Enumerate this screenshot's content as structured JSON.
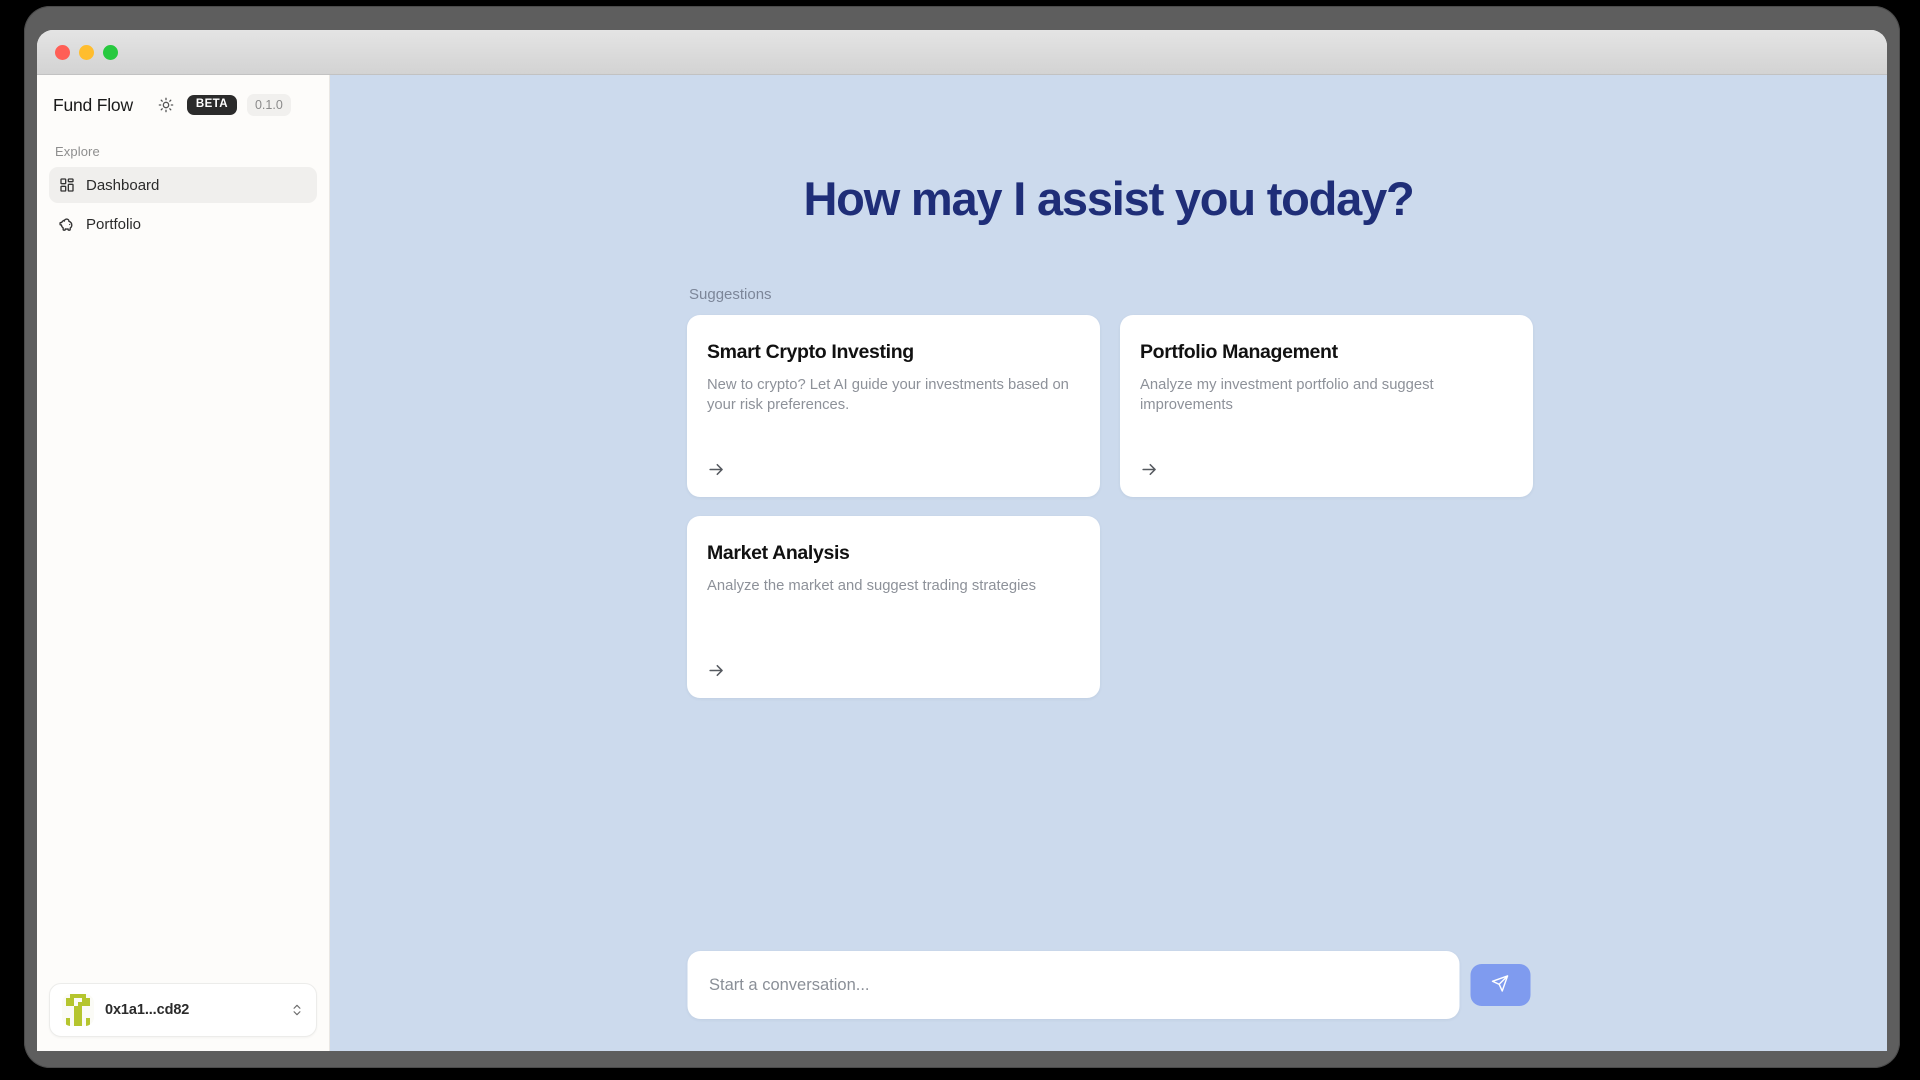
{
  "window": {
    "traffic_lights": [
      "close",
      "minimize",
      "maximize"
    ]
  },
  "sidebar": {
    "brand": "Fund Flow",
    "theme_toggle_icon": "sun-icon",
    "beta_badge": "BETA",
    "version": "0.1.0",
    "section_label": "Explore",
    "items": [
      {
        "label": "Dashboard",
        "icon": "dashboard-grid-icon",
        "active": true
      },
      {
        "label": "Portfolio",
        "icon": "piggy-bank-icon",
        "active": false
      }
    ],
    "wallet": {
      "address": "0x1a1...cd82",
      "avatar_icon": "wallet-identicon",
      "avatar_color": "#b5c52e",
      "chevron_icon": "chevron-up-down-icon"
    }
  },
  "main": {
    "hero_title": "How may I assist you today?",
    "suggestions_label": "Suggestions",
    "suggestions": [
      {
        "title": "Smart Crypto Investing",
        "description": "New to crypto? Let AI guide your investments based on your risk preferences.",
        "arrow_icon": "arrow-right-icon"
      },
      {
        "title": "Portfolio Management",
        "description": "Analyze my investment portfolio and suggest improvements",
        "arrow_icon": "arrow-right-icon"
      },
      {
        "title": "Market Analysis",
        "description": "Analyze the market and suggest trading strategies",
        "arrow_icon": "arrow-right-icon"
      }
    ],
    "composer": {
      "placeholder": "Start a conversation...",
      "value": "",
      "send_icon": "send-paper-plane-icon"
    }
  },
  "colors": {
    "main_background": "#ccdaed",
    "sidebar_background": "#fdfcfa",
    "hero_title": "#1f2e78",
    "send_button": "#7f9bef",
    "beta_badge": "#2b2b2b"
  }
}
